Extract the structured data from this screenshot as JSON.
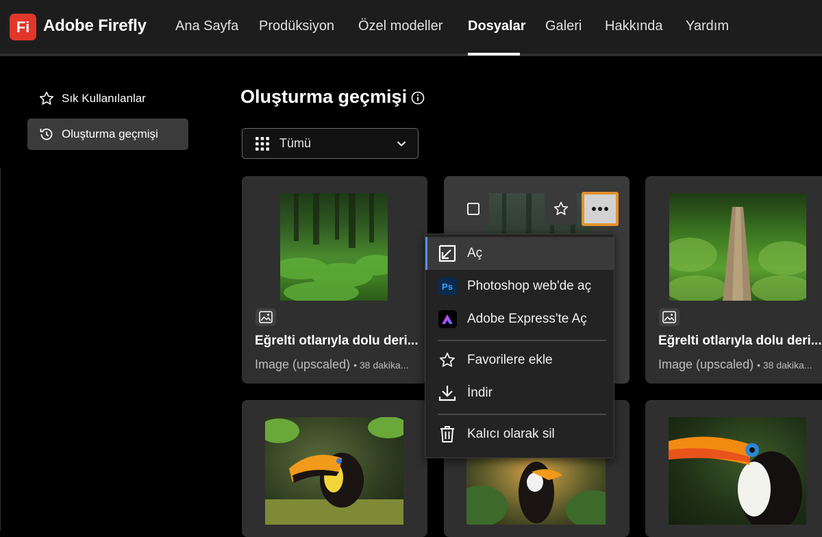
{
  "app": {
    "logo_text": "Fi",
    "name": "Adobe Firefly",
    "accent": "#e0372a"
  },
  "nav": {
    "items": [
      {
        "label": "Ana Sayfa"
      },
      {
        "label": "Prodüksiyon"
      },
      {
        "label": "Özel modeller"
      },
      {
        "label": "Dosyalar",
        "active": true
      },
      {
        "label": "Galeri"
      },
      {
        "label": "Hakkında"
      },
      {
        "label": "Yardım"
      }
    ]
  },
  "sidebar": {
    "items": [
      {
        "label": "Sık Kullanılanlar",
        "icon": "star-icon"
      },
      {
        "label": "Oluşturma geçmişi",
        "icon": "history-icon",
        "active": true
      }
    ]
  },
  "main": {
    "title": "Oluşturma geçmişi",
    "filter": {
      "value": "Tümü"
    }
  },
  "cards": [
    {
      "title": "Eğrelti otlarıyla dolu deri...",
      "type": "Image (upscaled)",
      "time": "• 38 dakika...",
      "subject": "fern forest"
    },
    {
      "title": "",
      "type": "",
      "time": "",
      "subject": "misty forest"
    },
    {
      "title": "Eğrelti otlarıyla dolu deri...",
      "type": "Image (upscaled)",
      "time": "• 38 dakika...",
      "subject": "fern forest log"
    },
    {
      "subject": "toucan"
    },
    {
      "subject": "toucan"
    },
    {
      "subject": "toucan"
    }
  ],
  "context_menu": {
    "items": [
      {
        "label": "Aç",
        "icon": "open-icon"
      },
      {
        "label": "Photoshop web'de aç",
        "icon": "photoshop-icon",
        "badge": "Ps"
      },
      {
        "label": "Adobe Express'te Aç",
        "icon": "adobe-express-icon"
      },
      {
        "label": "Favorilere ekle",
        "icon": "star-icon"
      },
      {
        "label": "İndir",
        "icon": "download-icon"
      },
      {
        "label": "Kalıcı olarak sil",
        "icon": "trash-icon"
      }
    ]
  },
  "colors": {
    "highlight_border": "#e3922e",
    "menu_accent": "#5b8fe0"
  }
}
